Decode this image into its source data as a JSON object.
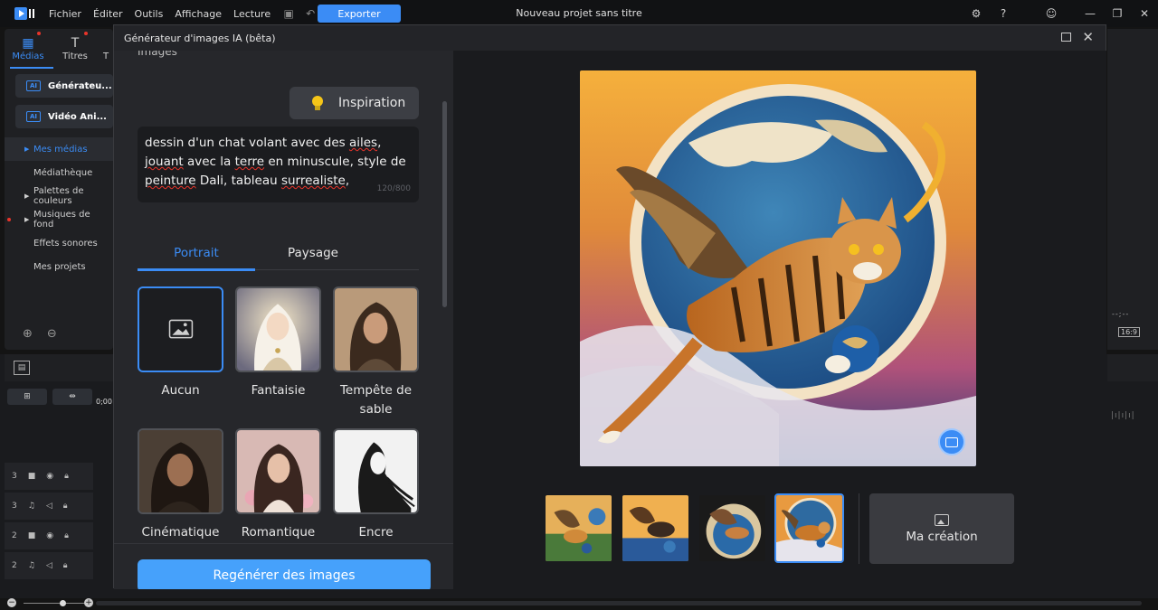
{
  "menubar": {
    "items": [
      "Fichier",
      "Éditer",
      "Outils",
      "Affichage",
      "Lecture"
    ],
    "export_label": "Exporter",
    "project_title": "Nouveau projet sans titre"
  },
  "left_panel": {
    "tabs": [
      {
        "label": "Médias",
        "icon": "media-icon",
        "active": true
      },
      {
        "label": "Titres",
        "icon": "titles-icon",
        "active": false
      },
      {
        "label": "T",
        "icon": "transition-icon",
        "active": false
      }
    ],
    "ai_buttons": [
      "Générateu...",
      "Vidéo Ani..."
    ],
    "nav": [
      {
        "label": "Mes médias",
        "active": true,
        "arrow": true
      },
      {
        "label": "Médiathèque",
        "active": false,
        "arrow": false
      },
      {
        "label": "Palettes de couleurs",
        "active": false,
        "arrow": true
      },
      {
        "label": "Musiques de fond",
        "active": false,
        "arrow": true,
        "dot": true
      },
      {
        "label": "Effets sonores",
        "active": false,
        "arrow": false
      },
      {
        "label": "Mes projets",
        "active": false,
        "arrow": false
      }
    ]
  },
  "timeline": {
    "time": "0;00",
    "tracks": [
      {
        "number": "3",
        "type": "video"
      },
      {
        "number": "3",
        "type": "audio"
      },
      {
        "number": "2",
        "type": "video"
      },
      {
        "number": "2",
        "type": "audio"
      }
    ]
  },
  "preview": {
    "time": "--;--",
    "ratio": "16:9"
  },
  "dialog": {
    "title": "Générateur d'images IA (bêta)",
    "section_label": "Images",
    "inspiration_label": "Inspiration",
    "prompt_parts": [
      {
        "text": "dessin d'un chat volant avec des ",
        "sq": false
      },
      {
        "text": "ailes",
        "sq": true
      },
      {
        "text": ", ",
        "sq": false
      },
      {
        "text": "jouant",
        "sq": true
      },
      {
        "text": " avec la ",
        "sq": false
      },
      {
        "text": "terre",
        "sq": true
      },
      {
        "text": " en minuscule, style de ",
        "sq": false
      },
      {
        "text": "peinture",
        "sq": true
      },
      {
        "text": " Dali, tableau ",
        "sq": false
      },
      {
        "text": "surrealiste",
        "sq": true
      },
      {
        "text": ",",
        "sq": false
      }
    ],
    "char_count": "120/800",
    "tabs": [
      "Portrait",
      "Paysage"
    ],
    "active_tab": "Portrait",
    "styles": [
      {
        "label": "Aucun",
        "selected": true
      },
      {
        "label": "Fantaisie",
        "selected": false
      },
      {
        "label": "Tempête de sable",
        "selected": false
      },
      {
        "label": "Cinématique",
        "selected": false
      },
      {
        "label": "Romantique",
        "selected": false
      },
      {
        "label": "Encre",
        "selected": false
      }
    ],
    "regenerate_label": "Regénérer des images",
    "my_creation_label": "Ma création",
    "selected_thumbnail": 4,
    "accent": "#3b8cf5"
  }
}
